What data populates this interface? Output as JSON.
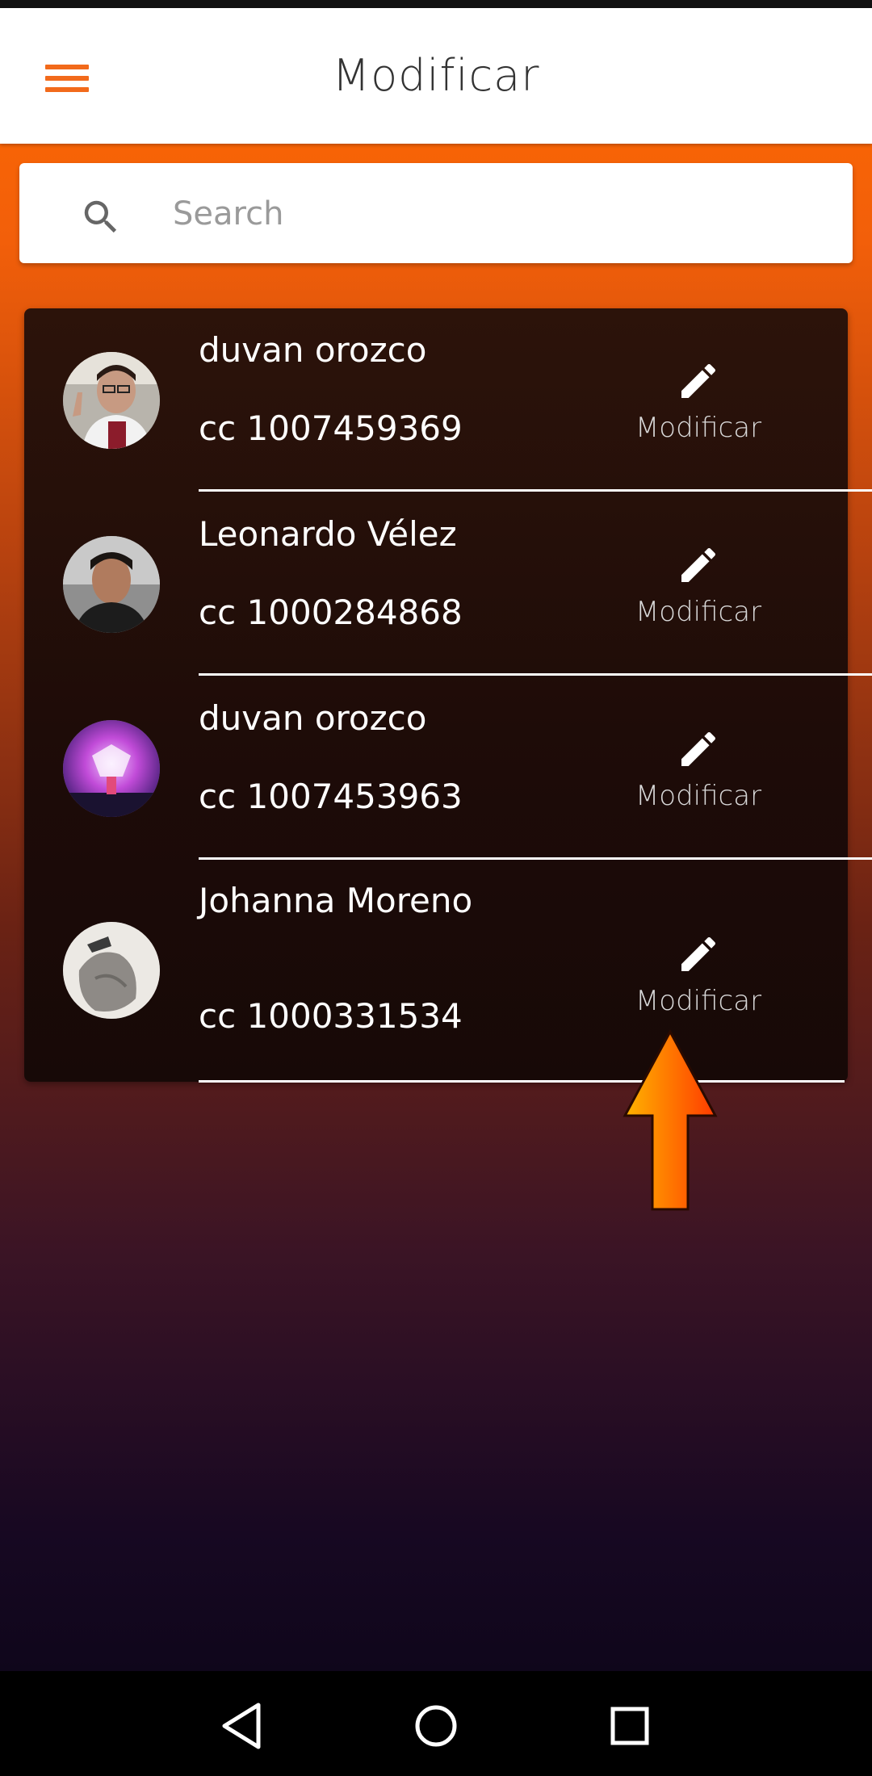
{
  "app_bar": {
    "title": "Modificar",
    "menu_icon": "hamburger-menu-icon",
    "accent_color": "#f26a1b"
  },
  "search": {
    "placeholder": "Search",
    "value": "",
    "icon": "search-icon"
  },
  "users": [
    {
      "name": "duvan orozco",
      "id": "cc 1007459369",
      "action_label": "Modificar",
      "action_icon": "pencil-icon"
    },
    {
      "name": "Leonardo Vélez",
      "id": "cc 1000284868",
      "action_label": "Modificar",
      "action_icon": "pencil-icon"
    },
    {
      "name": "duvan orozco",
      "id": "cc 1007453963",
      "action_label": "Modificar",
      "action_icon": "pencil-icon"
    },
    {
      "name": "Johanna Moreno",
      "id": "cc 1000331534",
      "action_label": "Modificar",
      "action_icon": "pencil-icon"
    }
  ],
  "annotation": {
    "icon": "up-arrow-icon",
    "colors": [
      "#ffb300",
      "#ff3b00"
    ]
  },
  "nav_bar": {
    "back_icon": "back-triangle-icon",
    "home_icon": "home-circle-icon",
    "recents_icon": "recents-square-icon"
  }
}
